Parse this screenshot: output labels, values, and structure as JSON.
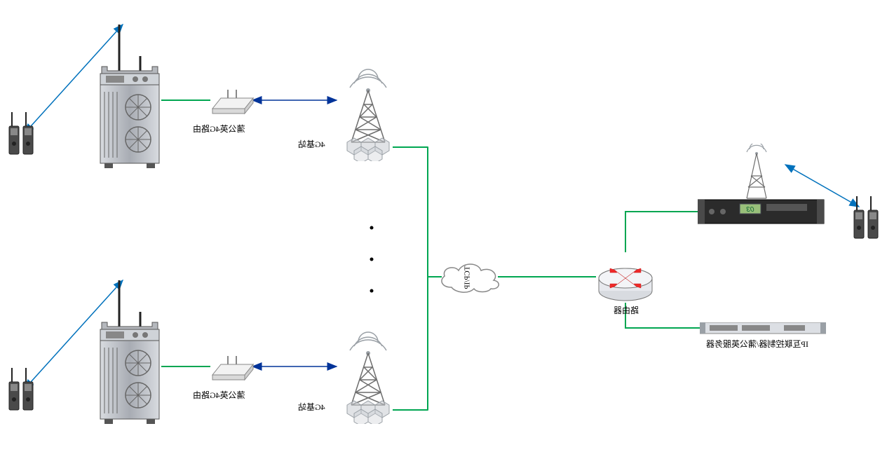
{
  "diagram": {
    "cloud_label": "TCP/IP",
    "router_label": "路由器",
    "server_label": "IP互联控制器/蒲公英服务器",
    "rack_display": "03",
    "nodes": {
      "remote1": {
        "router_label": "蒲公英4G路由",
        "tower_label": "4G基站"
      },
      "remote2": {
        "router_label": "蒲公英4G路由",
        "tower_label": "4G基站"
      }
    },
    "ellipsis": "•"
  },
  "colors": {
    "green": "#00a651",
    "blue": "#0071bc",
    "navy": "#003399",
    "red": "#ef2929",
    "gray": "#6d6d6d"
  }
}
